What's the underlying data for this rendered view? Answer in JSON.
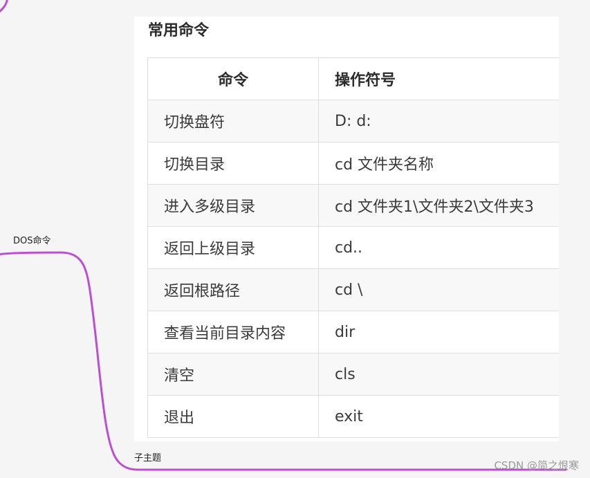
{
  "nodes": {
    "dos_label": "DOS命令",
    "sub_label": "子主题"
  },
  "card": {
    "title": "常用命令",
    "headers": [
      "命令",
      "操作符号"
    ],
    "rows": [
      {
        "command": "切换盘符",
        "symbol": "D: d:"
      },
      {
        "command": "切换目录",
        "symbol": "cd 文件夹名称"
      },
      {
        "command": "进入多级目录",
        "symbol": "cd 文件夹1\\文件夹2\\文件夹3"
      },
      {
        "command": "返回上级目录",
        "symbol": "cd.."
      },
      {
        "command": "返回根路径",
        "symbol": "cd \\"
      },
      {
        "command": "查看当前目录内容",
        "symbol": "dir"
      },
      {
        "command": "清空",
        "symbol": "cls"
      },
      {
        "command": "退出",
        "symbol": "exit"
      }
    ]
  },
  "watermark": "CSDN @简之恨寒",
  "colors": {
    "connector": "#bb4fd0",
    "background": "#f5f5f6",
    "card": "#ffffff",
    "border": "#dedede"
  }
}
